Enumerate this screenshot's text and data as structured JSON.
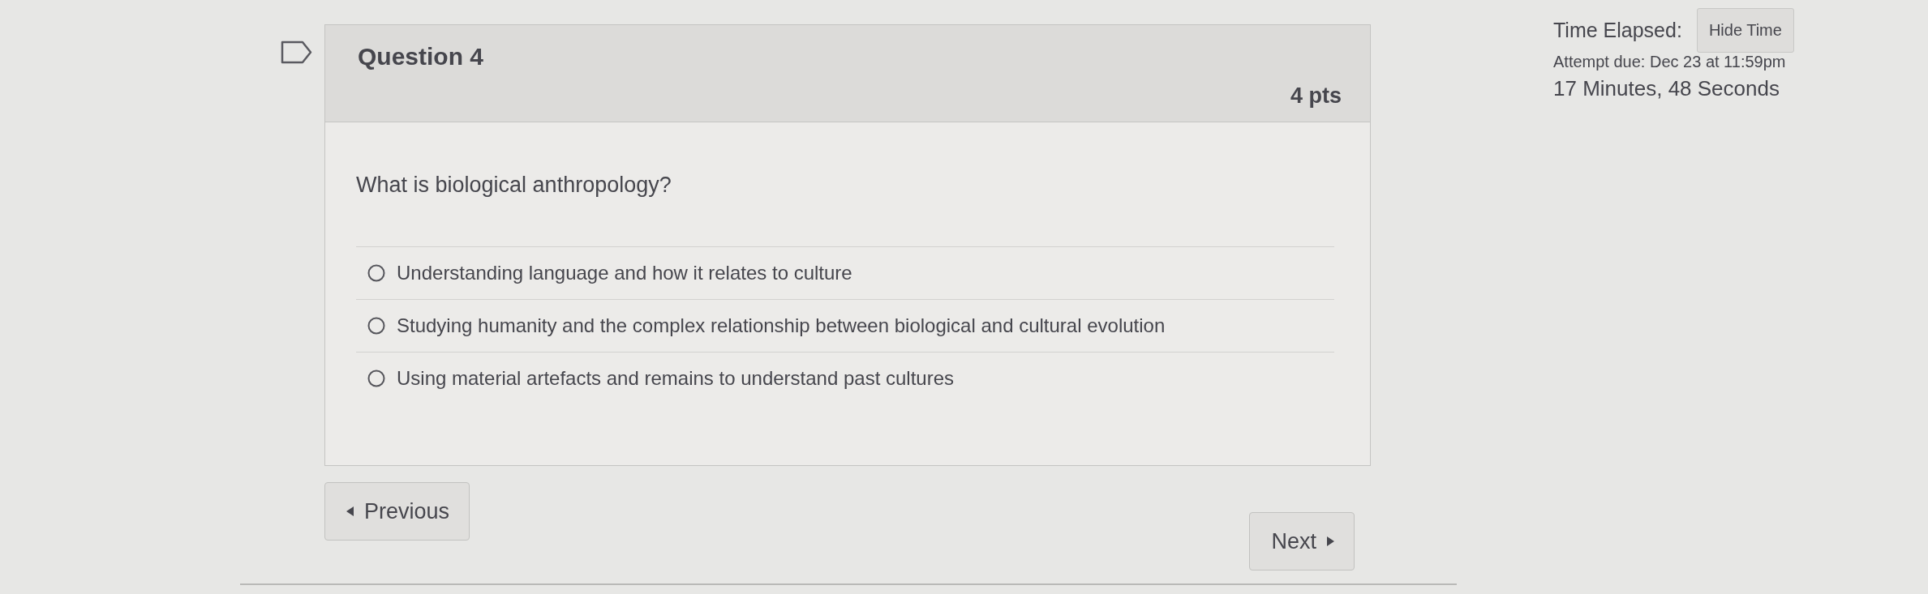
{
  "question": {
    "title": "Question 4",
    "points": "4 pts",
    "text": "What is biological anthropology?",
    "answers": [
      {
        "label": "Understanding language and how it relates to culture",
        "selected": false
      },
      {
        "label": "Studying humanity and the complex relationship between biological and cultural evolution",
        "selected": false
      },
      {
        "label": "Using material artefacts and remains to understand past cultures",
        "selected": false
      }
    ]
  },
  "navigation": {
    "previous": "Previous",
    "next": "Next"
  },
  "timer": {
    "label": "Time Elapsed:",
    "toggle_button": "Hide Time",
    "due": "Attempt due: Dec 23 at 11:59pm",
    "elapsed": "17 Minutes, 48 Seconds"
  }
}
